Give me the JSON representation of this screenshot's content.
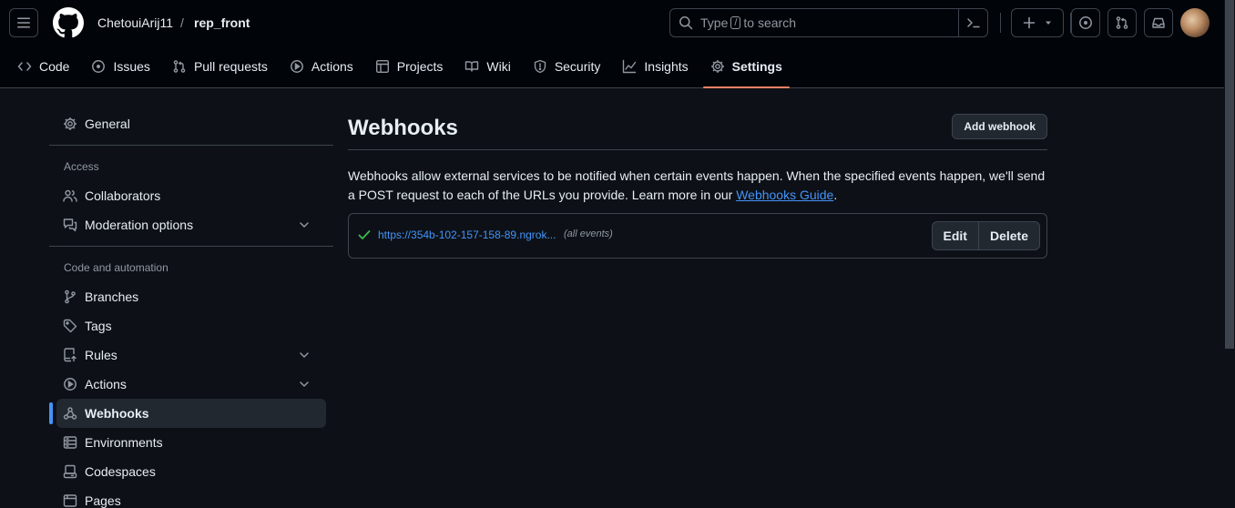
{
  "header": {
    "owner": "ChetouiArij11",
    "separator": "/",
    "repo": "rep_front",
    "search": {
      "prefix": "Type",
      "key": "/",
      "suffix": "to search"
    }
  },
  "repo_nav": [
    {
      "label": "Code",
      "icon": "code-icon"
    },
    {
      "label": "Issues",
      "icon": "issue-opened-icon"
    },
    {
      "label": "Pull requests",
      "icon": "git-pull-request-icon"
    },
    {
      "label": "Actions",
      "icon": "play-icon"
    },
    {
      "label": "Projects",
      "icon": "table-icon"
    },
    {
      "label": "Wiki",
      "icon": "book-icon"
    },
    {
      "label": "Security",
      "icon": "shield-icon"
    },
    {
      "label": "Insights",
      "icon": "graph-icon"
    },
    {
      "label": "Settings",
      "icon": "gear-icon",
      "active": true
    }
  ],
  "sidebar": {
    "general": "General",
    "access_heading": "Access",
    "collaborators": "Collaborators",
    "moderation": "Moderation options",
    "code_heading": "Code and automation",
    "branches": "Branches",
    "tags": "Tags",
    "rules": "Rules",
    "actions": "Actions",
    "webhooks": "Webhooks",
    "environments": "Environments",
    "codespaces": "Codespaces",
    "pages": "Pages"
  },
  "main": {
    "title": "Webhooks",
    "add_button": "Add webhook",
    "description": "Webhooks allow external services to be notified when certain events happen. When the specified events happen, we'll send a POST request to each of the URLs you provide. Learn more in our ",
    "guide_link": "Webhooks Guide",
    "description_end": ".",
    "hook": {
      "url": "https://354b-102-157-158-89.ngrok...",
      "events": "(all events)",
      "edit": "Edit",
      "delete": "Delete"
    }
  },
  "colors": {
    "background": "#0d1117",
    "header": "#010409",
    "accent_tab": "#f78166",
    "link": "#4493f8",
    "success": "#3fb950"
  }
}
